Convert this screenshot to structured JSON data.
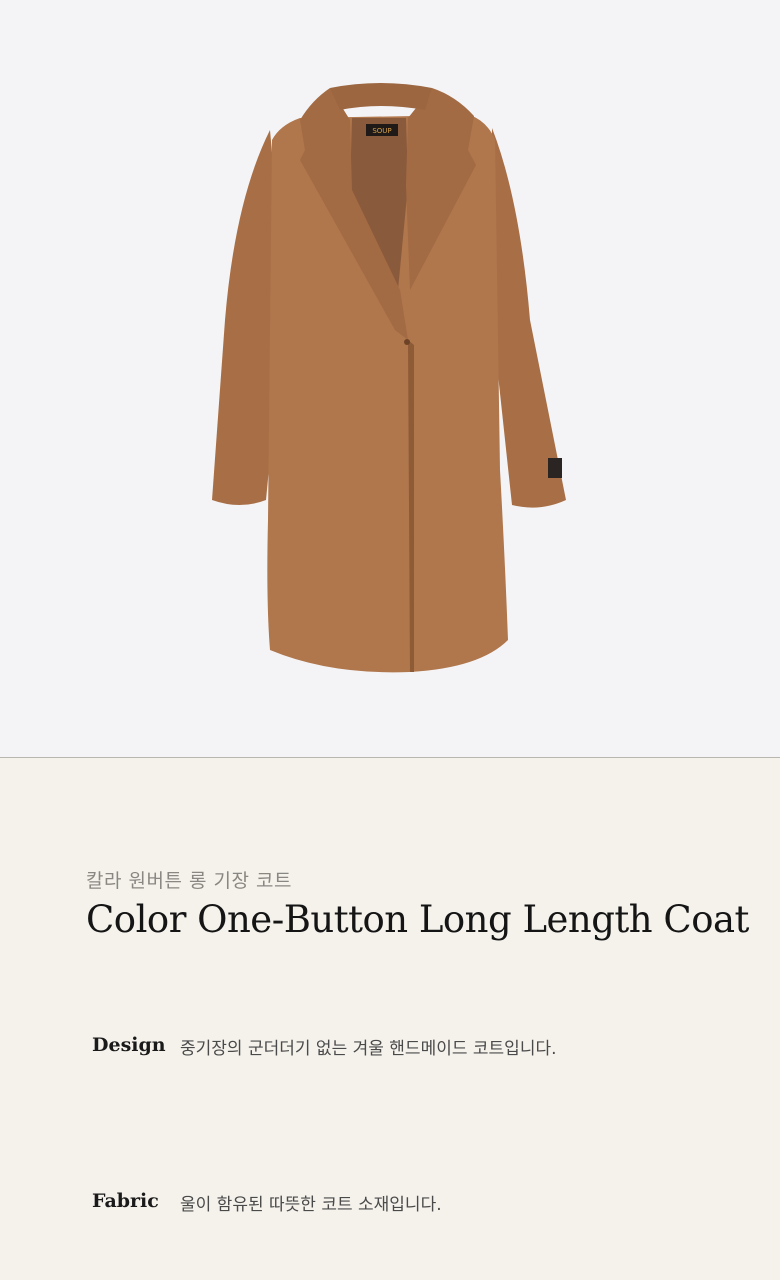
{
  "product_image": {
    "brand_tag": "SOUP",
    "colors": {
      "coat": "#b0764c",
      "coat_shadow": "#9c6640",
      "lining": "#8a5a3c",
      "collar_dark": "#a06a43",
      "label": "#2a2522",
      "background": "#f4f4f7"
    }
  },
  "product": {
    "subtitle": "칼라 원버튼 롱 기장 코트",
    "title": "Color One-Button Long Length Coat"
  },
  "specs": [
    {
      "label": "Design",
      "value": "중기장의 군더더기 없는 겨울 핸드메이드 코트입니다."
    },
    {
      "label": "Fabric",
      "value": "울이 함유된 따뜻한 코트 소재입니다."
    }
  ]
}
